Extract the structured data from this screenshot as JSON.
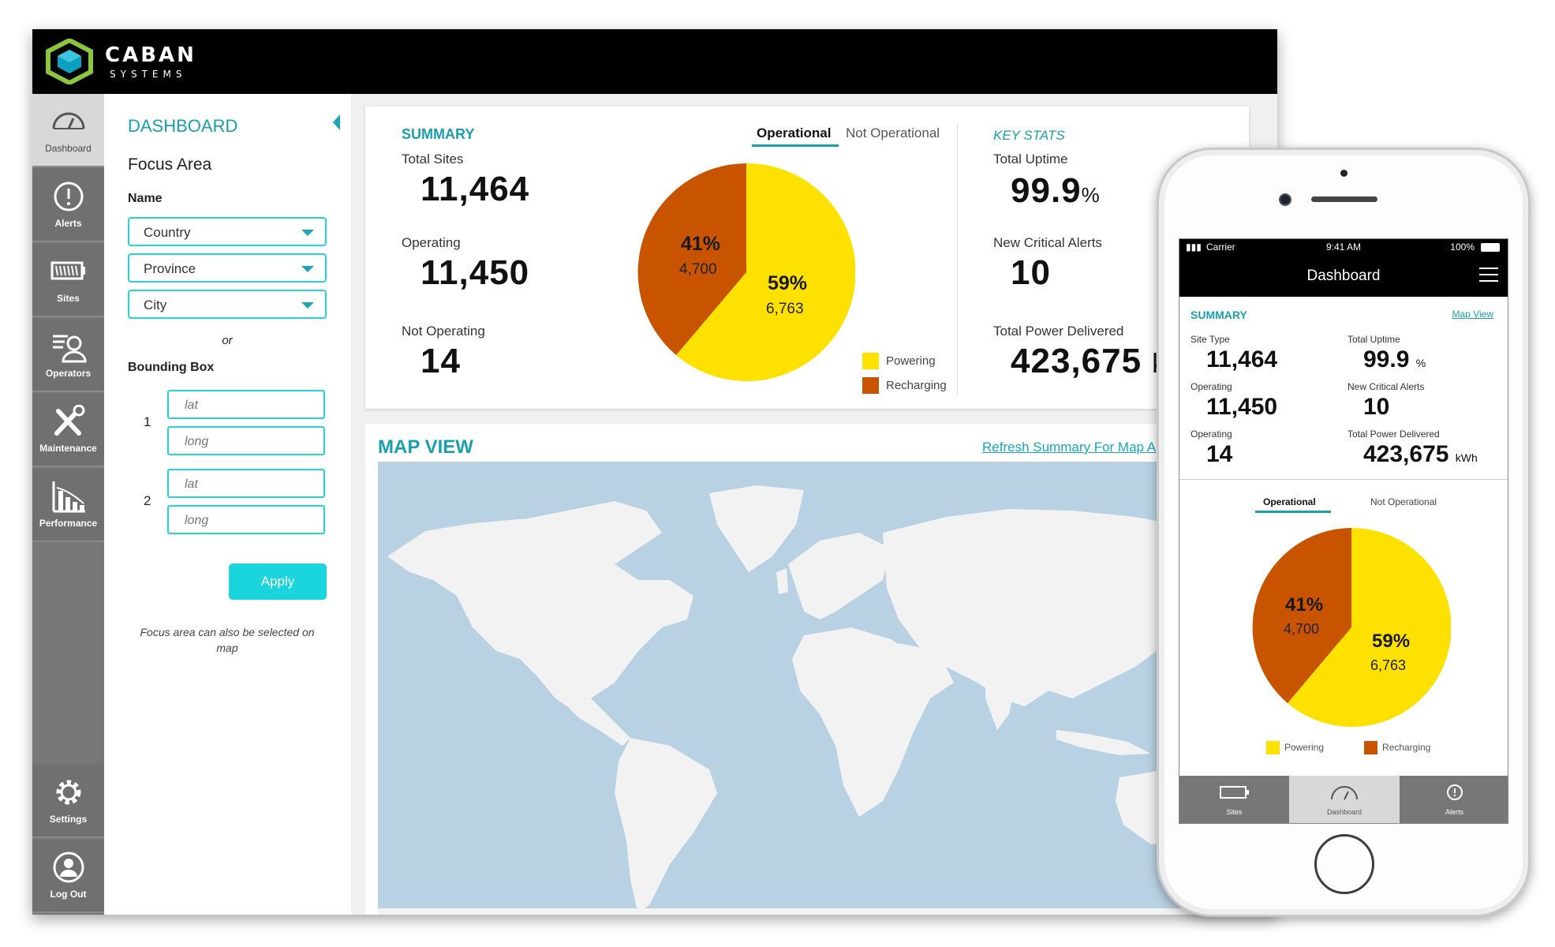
{
  "brand": {
    "name": "CABAN",
    "sub": "SYSTEMS"
  },
  "colors": {
    "accent": "#1a9fb0",
    "input_border": "#2ad0d8",
    "button": "#1ad5de",
    "powering": "#ffe100",
    "recharging": "#c95400"
  },
  "rail": {
    "items": [
      {
        "label": "Dashboard",
        "icon": "gauge-icon"
      },
      {
        "label": "Alerts",
        "icon": "alert-icon"
      },
      {
        "label": "Sites",
        "icon": "battery-icon"
      },
      {
        "label": "Operators",
        "icon": "operators-icon"
      },
      {
        "label": "Maintenance",
        "icon": "tools-icon"
      },
      {
        "label": "Performance",
        "icon": "chart-icon"
      },
      {
        "label": "Settings",
        "icon": "gear-icon"
      },
      {
        "label": "Log Out",
        "icon": "user-icon"
      }
    ]
  },
  "focus": {
    "title": "DASHBOARD",
    "heading": "Focus Area",
    "name_label": "Name",
    "selects": [
      "Country",
      "Province",
      "City"
    ],
    "or": "or",
    "bbox_label": "Bounding Box",
    "box_numbers": [
      "1",
      "2"
    ],
    "lat_placeholder": "lat",
    "long_placeholder": "long",
    "apply": "Apply",
    "note": "Focus area can also be selected on map"
  },
  "summary": {
    "title": "SUMMARY",
    "stats": [
      {
        "label": "Total Sites",
        "value": "11,464"
      },
      {
        "label": "Operating",
        "value": "11,450"
      },
      {
        "label": "Not Operating",
        "value": "14"
      }
    ],
    "tabs": [
      "Operational",
      "Not Operational"
    ],
    "pie": {
      "recharging_pct": "41%",
      "recharging_count": "4,700",
      "powering_pct": "59%",
      "powering_count": "6,763"
    },
    "legend": [
      "Powering",
      "Recharging"
    ]
  },
  "key_stats": {
    "title": "KEY STATS",
    "uptime_label": "Total Uptime",
    "uptime_value": "99.9",
    "uptime_unit": "%",
    "alerts_label": "New Critical Alerts",
    "alerts_value": "10",
    "power_label": "Total Power Delivered",
    "power_value": "423,675",
    "power_unit_cut": "k"
  },
  "map": {
    "title": "MAP VIEW",
    "link": "Refresh Summary For Map A"
  },
  "phone": {
    "carrier": "Carrier",
    "time": "9:41 AM",
    "battery": "100%",
    "title": "Dashboard",
    "summary": "SUMMARY",
    "map_view": "Map View",
    "left": [
      {
        "label": "Site Type",
        "value": "11,464"
      },
      {
        "label": "Operating",
        "value": "11,450"
      },
      {
        "label": "Operating",
        "value": "14"
      }
    ],
    "right": [
      {
        "label": "Total Uptime",
        "value": "99.9",
        "unit": "%"
      },
      {
        "label": "New Critical Alerts",
        "value": "10",
        "unit": ""
      },
      {
        "label": "Total Power Delivered",
        "value": "423,675",
        "unit": "kWh"
      }
    ],
    "tabs": [
      "Operational",
      "Not Operational"
    ],
    "pie": {
      "recharging_pct": "41%",
      "recharging_count": "4,700",
      "powering_pct": "59%",
      "powering_count": "6,763"
    },
    "legend": [
      "Powering",
      "Recharging"
    ],
    "tabbar": [
      "Sites",
      "Dashboard",
      "Alerts"
    ]
  }
}
